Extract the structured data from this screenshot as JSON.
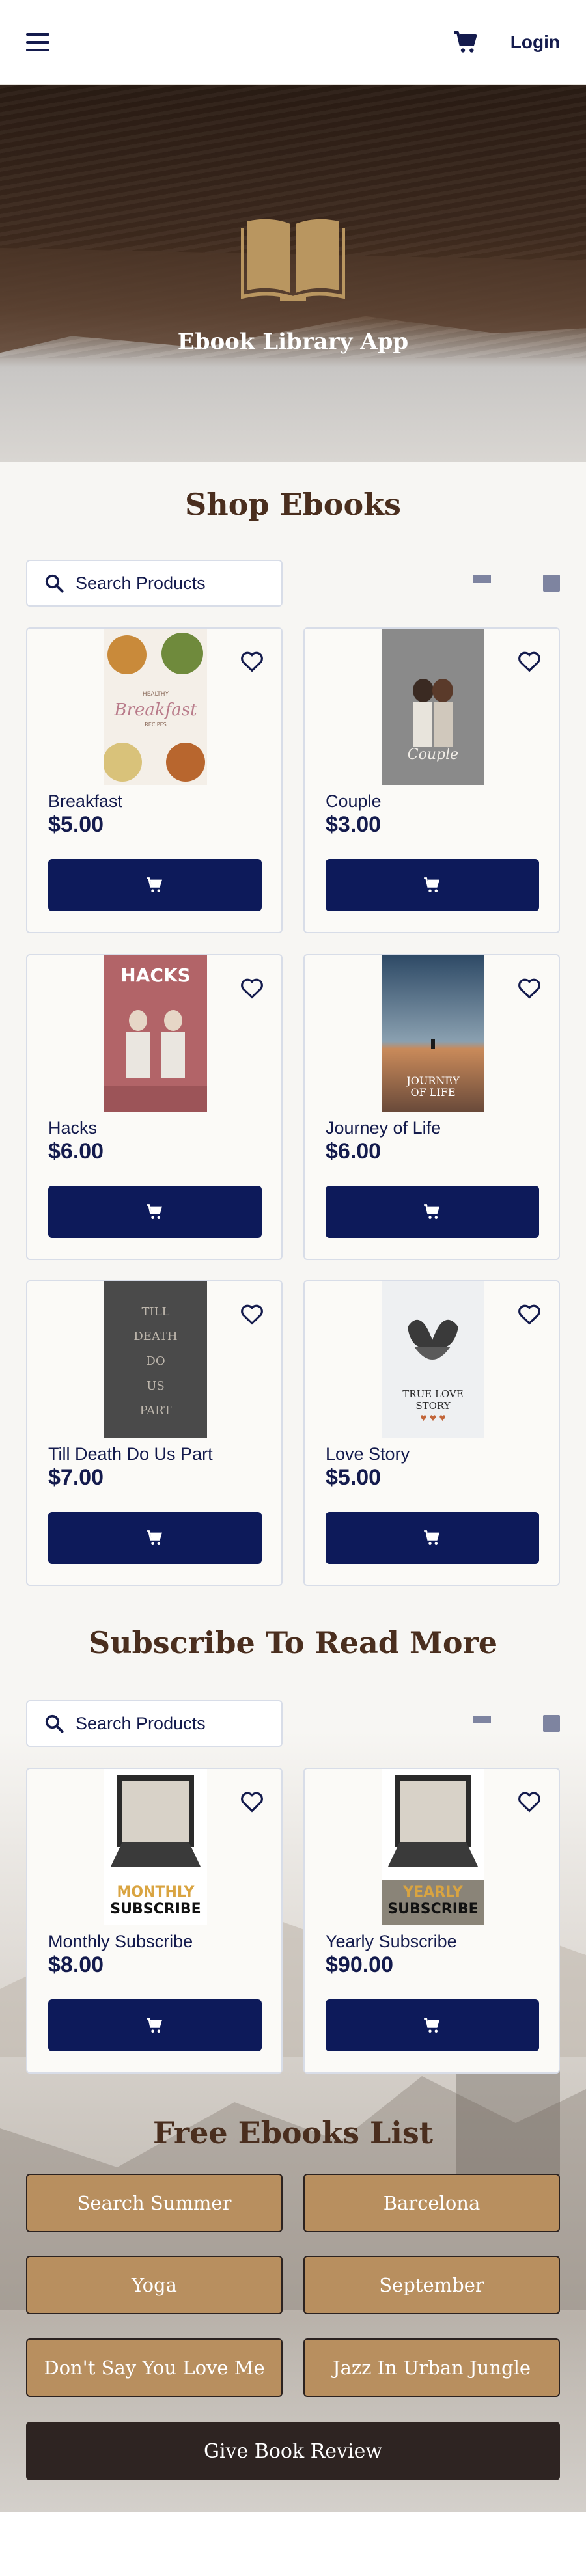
{
  "header": {
    "menu_icon": "hamburger-menu-icon",
    "cart_icon": "shopping-cart-icon",
    "login_label": "Login"
  },
  "hero": {
    "icon": "open-book-icon",
    "title": "Ebook Library App"
  },
  "shop": {
    "title": "Shop Ebooks",
    "search_placeholder": "Search Products",
    "products": [
      {
        "name": "Breakfast",
        "price": "$5.00",
        "cover_text": "HEALTHY Breakfast RECIPES"
      },
      {
        "name": "Couple",
        "price": "$3.00",
        "cover_text": "Couple"
      },
      {
        "name": "Hacks",
        "price": "$6.00",
        "cover_text": "HACKS"
      },
      {
        "name": "Journey of Life",
        "price": "$6.00",
        "cover_text": "JOURNEY OF LIFE"
      },
      {
        "name": "Till Death Do Us Part",
        "price": "$7.00",
        "cover_text": "TILL DEATH DO US PART"
      },
      {
        "name": "Love Story",
        "price": "$5.00",
        "cover_text": "TRUE LOVE STORY"
      }
    ]
  },
  "subscribe": {
    "title": "Subscribe To Read More",
    "search_placeholder": "Search Products",
    "products": [
      {
        "name": "Monthly Subscribe",
        "price": "$8.00",
        "cover_top": "MONTHLY",
        "cover_bottom": "SUBSCRIBE"
      },
      {
        "name": "Yearly Subscribe",
        "price": "$90.00",
        "cover_top": "YEARLY",
        "cover_bottom": "SUBSCRIBE"
      }
    ]
  },
  "free": {
    "title": "Free Ebooks  List",
    "items": [
      "Search Summer",
      "Barcelona",
      "Yoga",
      "September",
      "Don't Say You Love Me",
      "Jazz In Urban Jungle"
    ],
    "review_label": "Give Book Review"
  },
  "colors": {
    "navy": "#0d1a5a",
    "brown_title": "#4a2e1e",
    "tan_button": "#b88f5f",
    "dark_button": "#2e2422",
    "gold_icon": "#b99660"
  }
}
